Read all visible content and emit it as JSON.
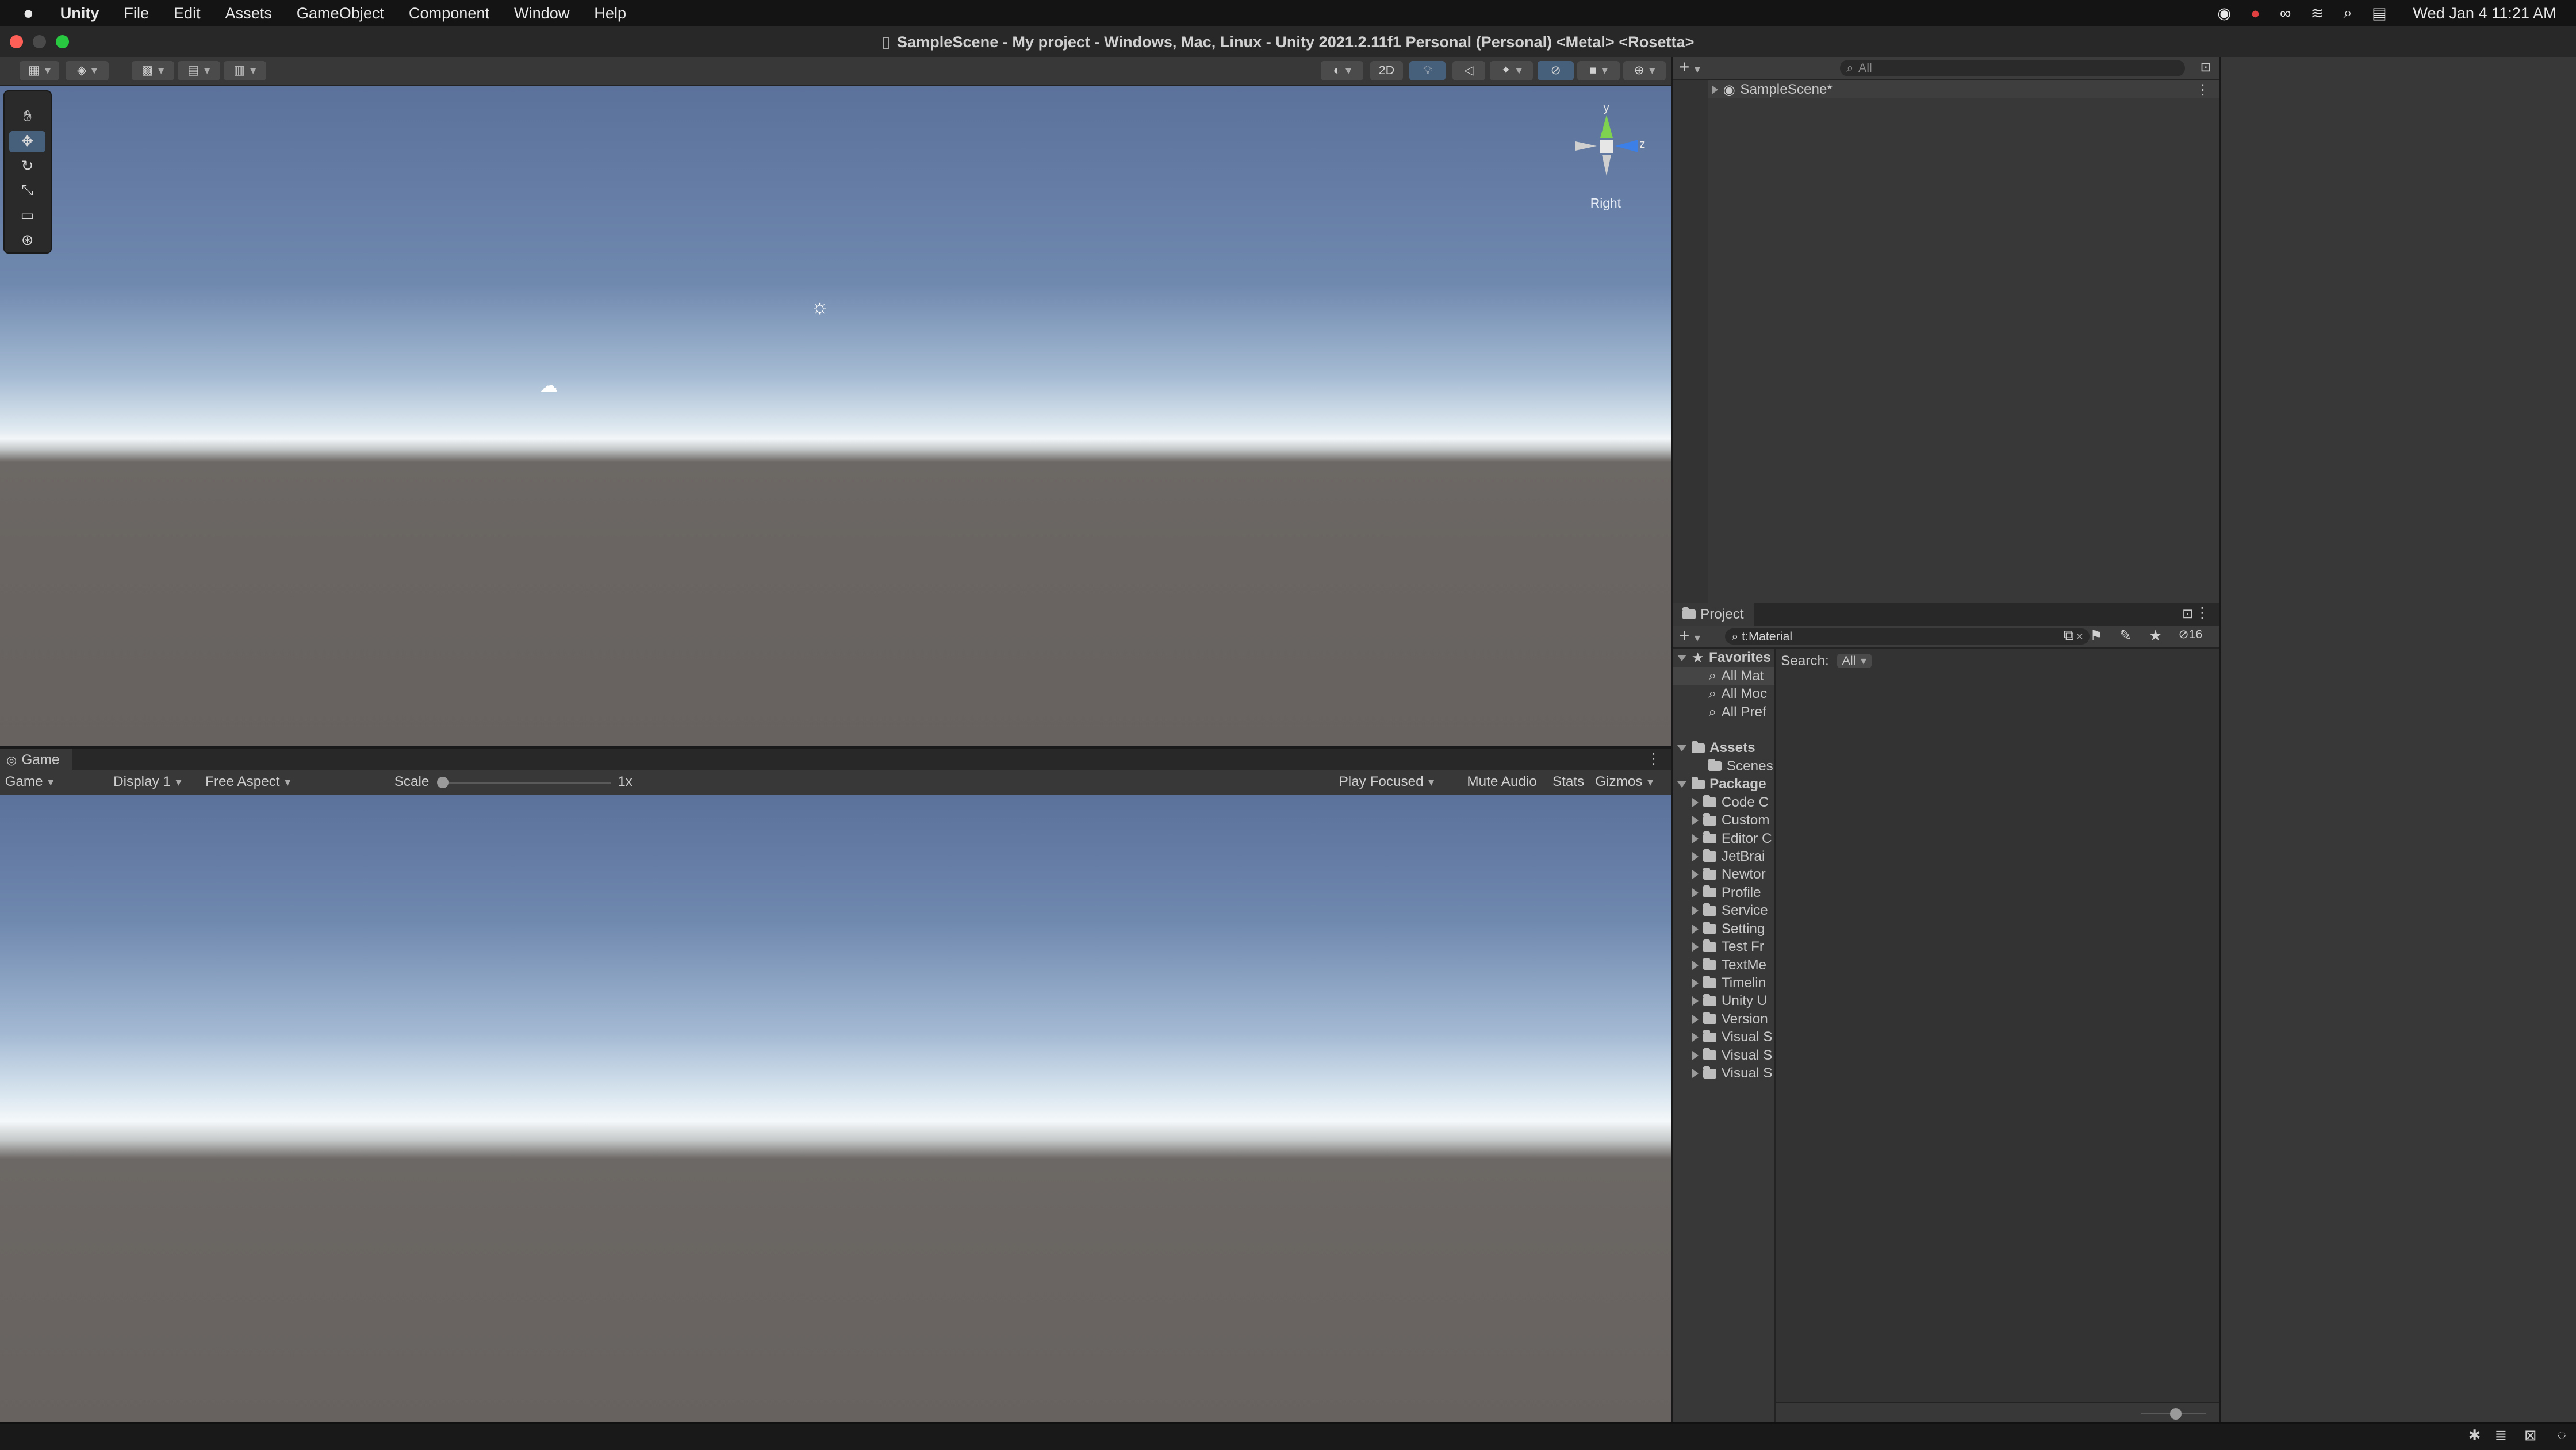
{
  "menubar": {
    "app": "Unity",
    "items": [
      "File",
      "Edit",
      "Assets",
      "GameObject",
      "Component",
      "Window",
      "Help"
    ],
    "clock": "Wed Jan 4  11:21 AM"
  },
  "window": {
    "title": "SampleScene - My project - Windows, Mac, Linux - Unity 2021.2.11f1 Personal (Personal) <Metal> <Rosetta>"
  },
  "scene": {
    "mode_2d": "2D",
    "gizmo_axis_y": "y",
    "gizmo_axis_z": "z",
    "gizmo_view": "Right"
  },
  "game": {
    "tab_label": "Game",
    "mode": "Game",
    "display": "Display 1",
    "aspect": "Free Aspect",
    "scale_label": "Scale",
    "scale_value": "1x",
    "play_focused": "Play Focused",
    "mute_audio": "Mute Audio",
    "stats": "Stats",
    "gizmos": "Gizmos"
  },
  "hierarchy": {
    "search_placeholder": "All",
    "scene_item": "SampleScene*"
  },
  "project": {
    "tab_label": "Project",
    "search_value": "t:Material",
    "hidden_count": "16",
    "search_label": "Search:",
    "search_scope": "All",
    "favorites": {
      "label": "Favorites",
      "items": [
        "All Mat",
        "All Moc",
        "All Pref"
      ]
    },
    "assets": {
      "label": "Assets",
      "items": [
        "Scenes"
      ]
    },
    "packages": {
      "label": "Package",
      "items": [
        "Code C",
        "Custom",
        "Editor C",
        "JetBrai",
        "Newtor",
        "Profile",
        "Service",
        "Setting",
        "Test Fr",
        "TextMe",
        "Timelin",
        "Unity U",
        "Version",
        "Visual S",
        "Visual S",
        "Visual S"
      ]
    }
  },
  "icons": [
    "apple-icon",
    "hand-tool-icon",
    "move-tool-icon",
    "rotate-tool-icon",
    "scale-tool-icon",
    "rect-tool-icon",
    "transform-tool-icon",
    "light-gizmo-icon",
    "cloud-gizmo-icon",
    "search-icon",
    "folder-icon",
    "star-icon",
    "lock-icon",
    "more-icon",
    "plus-icon"
  ],
  "colors": {
    "sky_top": "#5b729b",
    "horizon": "#f3f6f8",
    "ground": "#6a6562",
    "panel": "#383838",
    "close": "#fe5f57",
    "minimize": "#4a4a4a",
    "maximize": "#28c840"
  }
}
